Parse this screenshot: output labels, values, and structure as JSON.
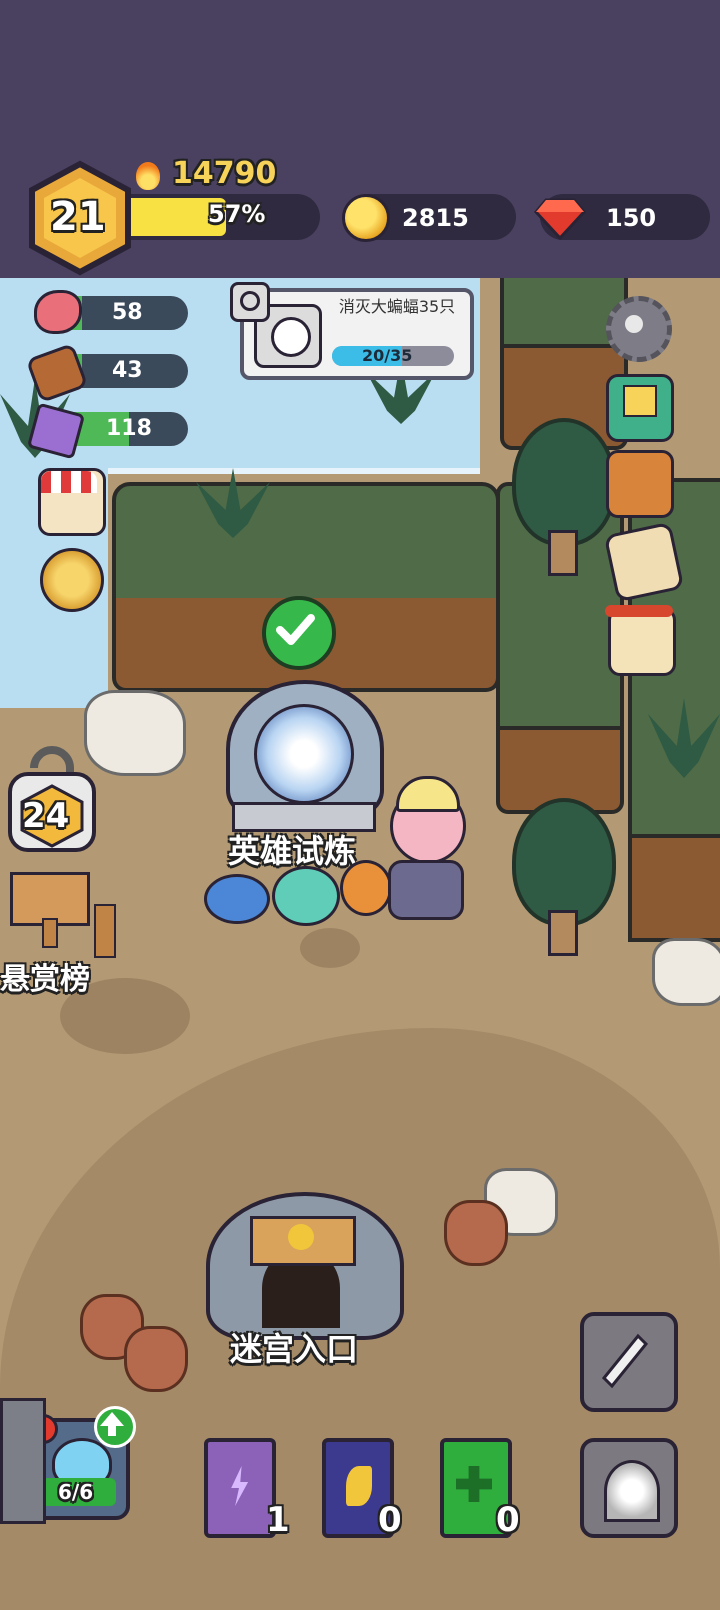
{
  "player": {
    "level": "21",
    "power": "14790",
    "xp_percent": "57%",
    "xp_fraction": 0.57
  },
  "currency": {
    "coins": "2815",
    "gems": "150"
  },
  "resources": [
    {
      "name": "meat",
      "value": "58",
      "fill": 0.2
    },
    {
      "name": "wood",
      "value": "43",
      "fill": 0.2
    },
    {
      "name": "crystal",
      "value": "118",
      "fill": 0.55
    }
  ],
  "quest": {
    "title": "消灭大蝙蝠35只",
    "progress_text": "20/35",
    "progress": 0.571
  },
  "map_labels": {
    "hero_trial": "英雄试炼",
    "bounty_board": "悬赏榜",
    "dungeon_entrance": "迷宫入口",
    "bounty_level": "24"
  },
  "party": {
    "count": "6/6"
  },
  "books": [
    {
      "name": "lightning-book",
      "count": "1",
      "color": "#8b62b8"
    },
    {
      "name": "wing-book",
      "count": "0",
      "color": "#3b3a8f"
    },
    {
      "name": "heal-book",
      "count": "0",
      "color": "#2fae3e"
    }
  ],
  "colors": {
    "xp_bar": "#f7e143",
    "grass": "#4f6b47",
    "water": "#b9def2",
    "dirt": "#b39a74",
    "quest_bar": "#3bbde8"
  }
}
